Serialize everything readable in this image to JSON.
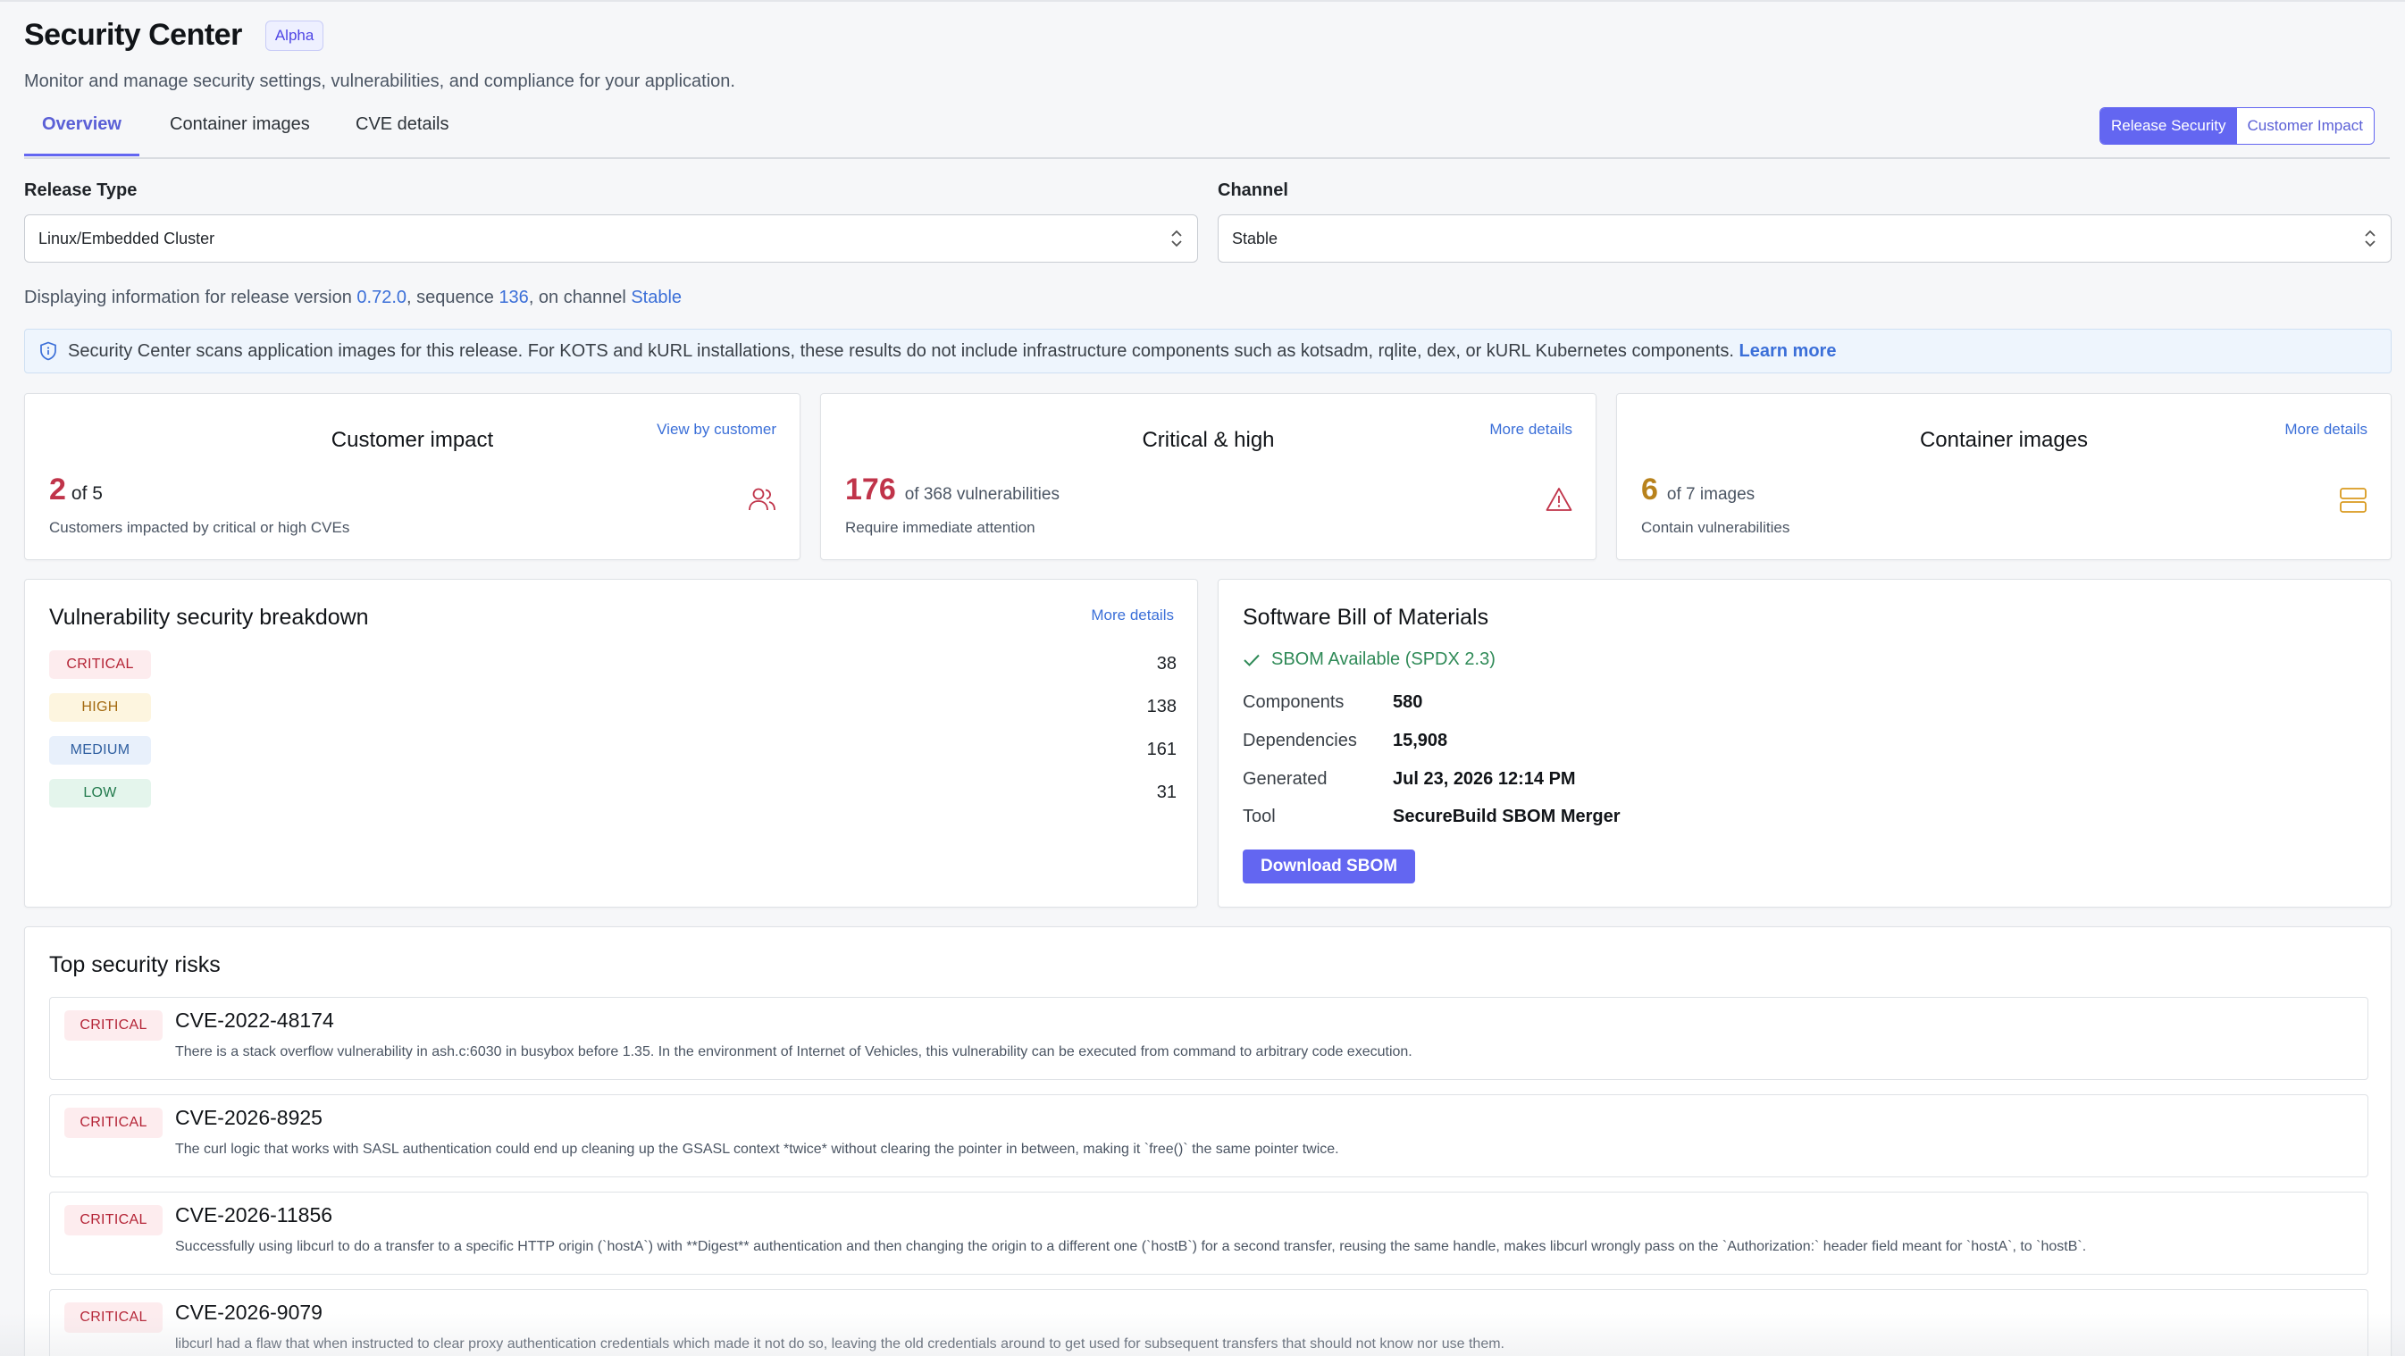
{
  "header": {
    "title": "Security Center",
    "badge": "Alpha",
    "subtitle": "Monitor and manage security settings, vulnerabilities, and compliance for your application."
  },
  "tabs": [
    {
      "label": "Overview",
      "active": true
    },
    {
      "label": "Container images",
      "active": false
    },
    {
      "label": "CVE details",
      "active": false
    }
  ],
  "view_toggle": {
    "primary": "Release Security",
    "secondary": "Customer Impact"
  },
  "filters": {
    "release_type": {
      "label": "Release Type",
      "value": "Linux/Embedded Cluster"
    },
    "channel": {
      "label": "Channel",
      "value": "Stable"
    }
  },
  "release_info": {
    "prefix": "Displaying information for release version ",
    "version": "0.72.0",
    "mid1": ", sequence ",
    "sequence": "136",
    "mid2": ", on channel ",
    "channel": "Stable"
  },
  "banner": {
    "text": "Security Center scans application images for this release. For KOTS and kURL installations, these results do not include infrastructure components such as kotsadm, rqlite, dex, or kURL Kubernetes components. ",
    "link": "Learn more"
  },
  "stats": {
    "customer_impact": {
      "title": "Customer impact",
      "link": "View by customer",
      "value": "2",
      "of": "of 5",
      "desc": "Customers impacted by critical or high CVEs",
      "color": "#c0344a"
    },
    "critical_high": {
      "title": "Critical & high",
      "link": "More details",
      "value": "176",
      "of": "of 368 vulnerabilities",
      "desc": "Require immediate attention",
      "color": "#c0344a"
    },
    "container_images": {
      "title": "Container images",
      "link": "More details",
      "value": "6",
      "of": "of 7 images",
      "desc": "Contain vulnerabilities",
      "color": "#b8821c"
    }
  },
  "breakdown": {
    "title": "Vulnerability security breakdown",
    "link": "More details",
    "rows": [
      {
        "label": "CRITICAL",
        "count": "38"
      },
      {
        "label": "HIGH",
        "count": "138"
      },
      {
        "label": "MEDIUM",
        "count": "161"
      },
      {
        "label": "LOW",
        "count": "31"
      }
    ]
  },
  "sbom": {
    "title": "Software Bill of Materials",
    "status": "SBOM Available (SPDX 2.3)",
    "rows": [
      {
        "key": "Components",
        "value": "580"
      },
      {
        "key": "Dependencies",
        "value": "15,908"
      },
      {
        "key": "Generated",
        "value": "Jul 23, 2026 12:14 PM"
      },
      {
        "key": "Tool",
        "value": "SecureBuild SBOM Merger"
      }
    ],
    "button": "Download SBOM"
  },
  "risks": {
    "title": "Top security risks",
    "items": [
      {
        "severity": "CRITICAL",
        "id": "CVE-2022-48174",
        "desc": "There is a stack overflow vulnerability in ash.c:6030 in busybox before 1.35. In the environment of Internet of Vehicles, this vulnerability can be executed from command to arbitrary code execution."
      },
      {
        "severity": "CRITICAL",
        "id": "CVE-2026-8925",
        "desc": "The curl logic that works with SASL authentication could end up cleaning up the GSASL context *twice* without clearing the pointer in between, making it `free()` the same pointer twice."
      },
      {
        "severity": "CRITICAL",
        "id": "CVE-2026-11856",
        "desc": "Successfully using libcurl to do a transfer to a specific HTTP origin (`hostA`) with **Digest** authentication and then changing the origin to a different one (`hostB`) for a second transfer, reusing the same handle, makes libcurl wrongly pass on the `Authorization:` header field meant for `hostA`, to `hostB`."
      },
      {
        "severity": "CRITICAL",
        "id": "CVE-2026-9079",
        "desc": "libcurl had a flaw that when instructed to clear proxy authentication credentials which made it not do so, leaving the old credentials around to get used for subsequent transfers that should not know nor use them."
      }
    ]
  },
  "colors": {
    "accent": "#6366f1",
    "link": "#3b6fd8",
    "critical": "#b42335",
    "success": "#2f8a57"
  }
}
